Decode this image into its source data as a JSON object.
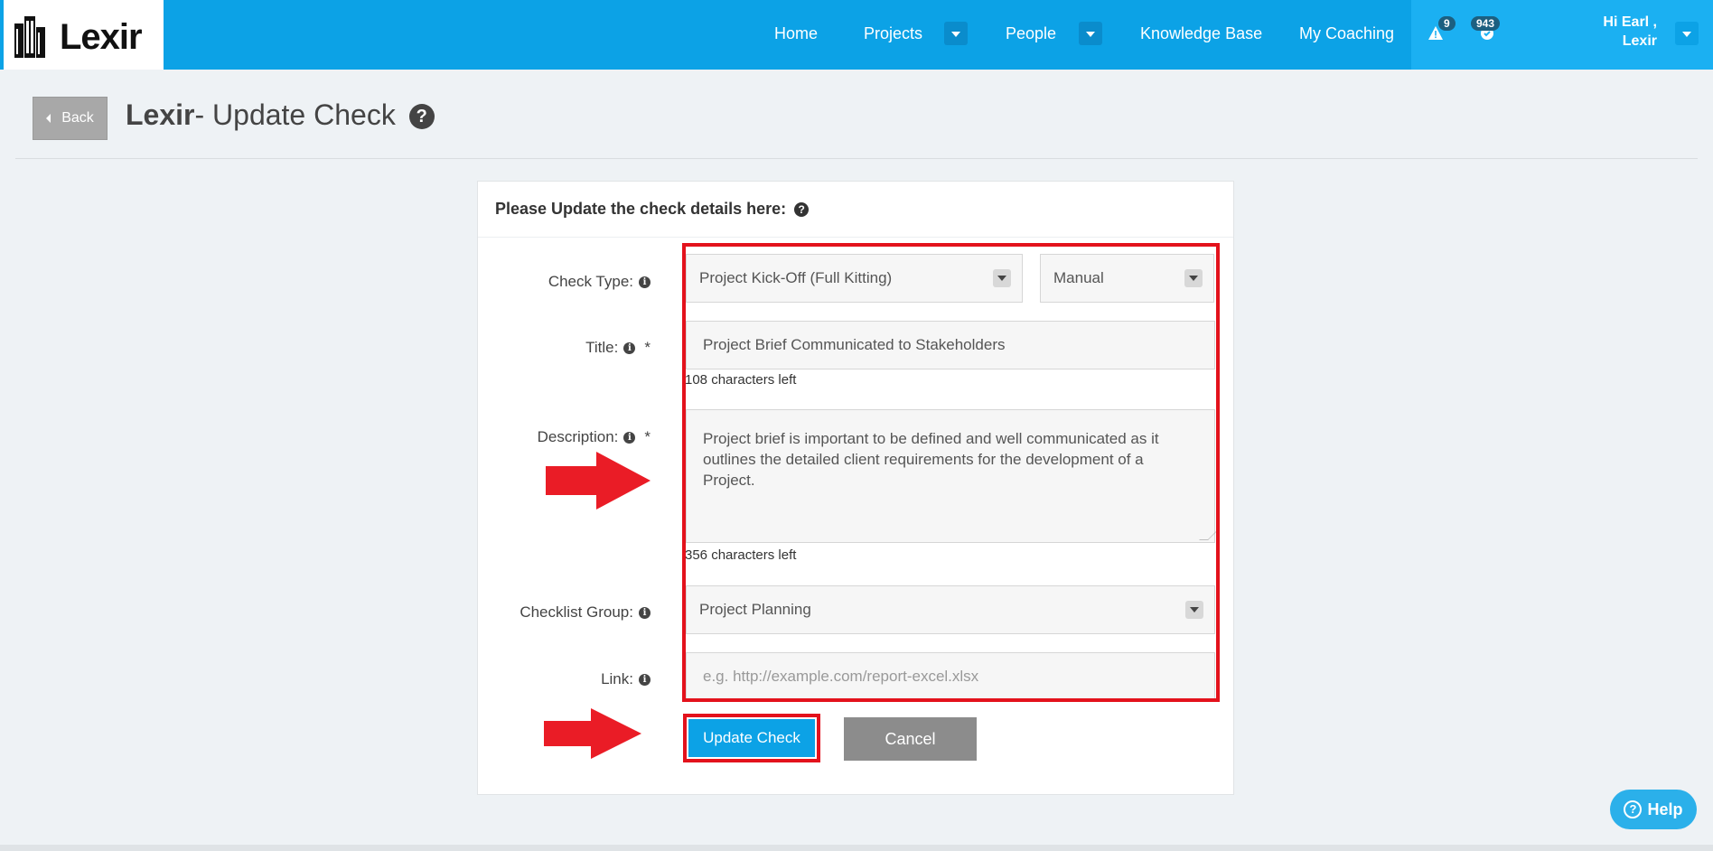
{
  "brand": {
    "name": "Lexir"
  },
  "nav": {
    "items": [
      {
        "label": "Home"
      },
      {
        "label": "Projects"
      },
      {
        "label": "People"
      },
      {
        "label": "Knowledge Base"
      },
      {
        "label": "My Coaching"
      }
    ],
    "alerts_count": "9",
    "notifications_count": "943",
    "user_greeting_line1": "Hi Earl ,",
    "user_greeting_line2": "Lexir"
  },
  "header": {
    "back_label": "Back",
    "title_brand": "Lexir",
    "title_rest": "- Update Check"
  },
  "form": {
    "heading": "Please Update the check details here:",
    "check_type_label": "Check Type:",
    "check_type_value": "Project Kick-Off (Full Kitting)",
    "check_mode_value": "Manual",
    "title_label": "Title:",
    "title_value": "Project Brief Communicated to Stakeholders",
    "title_chars_left": "108 characters left",
    "description_label": "Description:",
    "description_value": "Project brief is important to be defined and well communicated as it outlines the detailed client requirements for the development of a Project.",
    "description_chars_left": "356 characters left",
    "group_label": "Checklist Group:",
    "group_value": "Project Planning",
    "link_label": "Link:",
    "link_placeholder": "e.g. http://example.com/report-excel.xlsx",
    "required_mark": "*",
    "update_label": "Update Check",
    "cancel_label": "Cancel"
  },
  "help": {
    "label": "Help"
  },
  "colors": {
    "nav_bg": "#0ca2e6",
    "highlight_red": "#e3121c",
    "cancel_gray": "#8c8c8c"
  },
  "icons": [
    "building-logo-icon",
    "caret-down-icon",
    "alert-triangle-icon",
    "notification-icon",
    "info-icon",
    "question-circle-icon",
    "red-arrow"
  ]
}
